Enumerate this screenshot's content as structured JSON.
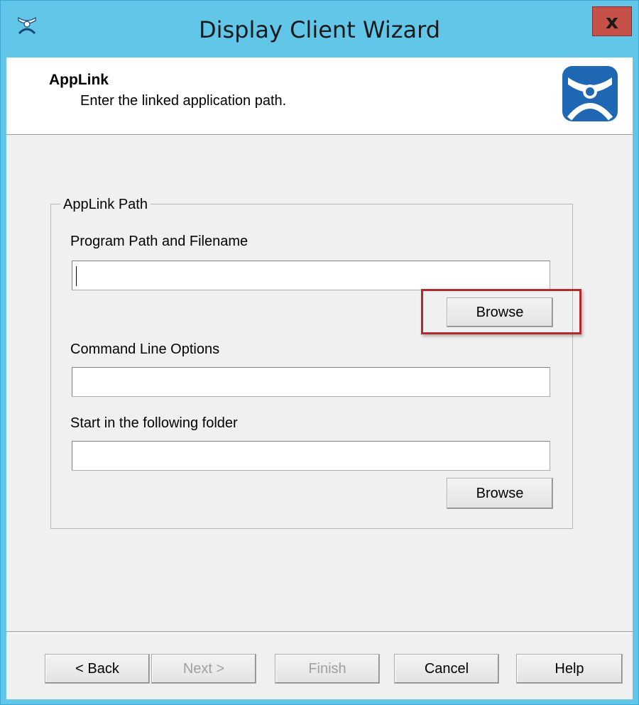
{
  "window": {
    "title": "Display Client Wizard",
    "close_label": "x"
  },
  "header": {
    "title": "AppLink",
    "subtitle": "Enter the linked application path."
  },
  "group": {
    "legend": "AppLink Path",
    "program_label": "Program Path and Filename",
    "program_value": "",
    "browse1_label": "Browse",
    "cmd_label": "Command Line Options",
    "cmd_value": "",
    "startin_label": "Start in the following folder",
    "startin_value": "",
    "browse2_label": "Browse"
  },
  "footer": {
    "back_label": "< Back",
    "next_label": "Next >",
    "finish_label": "Finish",
    "cancel_label": "Cancel",
    "help_label": "Help"
  },
  "colors": {
    "titlebar": "#62c6e9",
    "close_button": "#c7504a",
    "highlight": "#b22a2e",
    "logo": "#1f67b3"
  }
}
